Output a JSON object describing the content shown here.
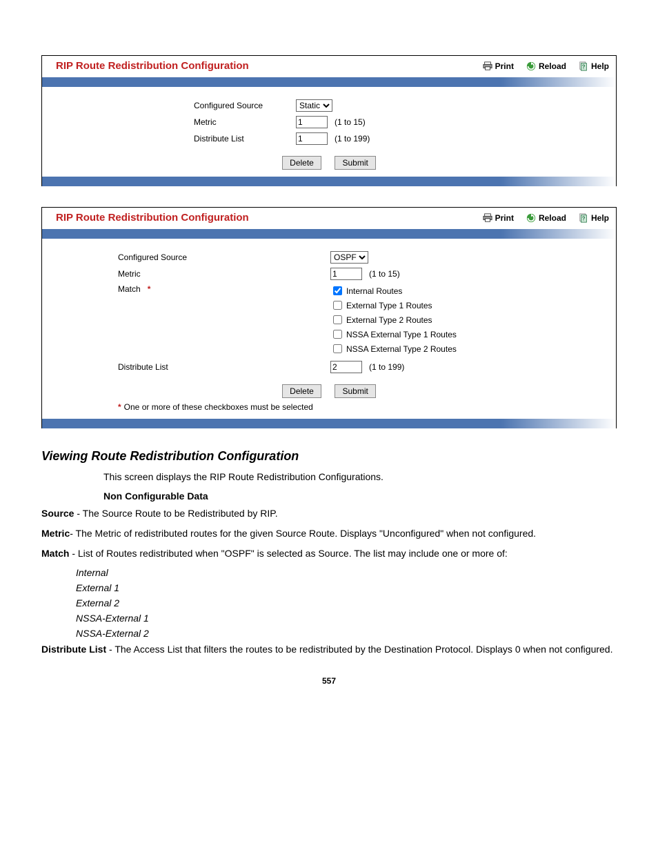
{
  "header_buttons": {
    "print": "Print",
    "reload": "Reload",
    "help": "Help"
  },
  "panel1": {
    "title": "RIP Route Redistribution Configuration",
    "configured_source_label": "Configured Source",
    "configured_source_value": "Static",
    "metric_label": "Metric",
    "metric_value": "1",
    "metric_hint": "(1 to 15)",
    "distribute_label": "Distribute List",
    "distribute_value": "1",
    "distribute_hint": "(1 to 199)",
    "delete_label": "Delete",
    "submit_label": "Submit"
  },
  "panel2": {
    "title": "RIP Route Redistribution Configuration",
    "configured_source_label": "Configured Source",
    "configured_source_value": "OSPF",
    "metric_label": "Metric",
    "metric_value": "1",
    "metric_hint": "(1 to 15)",
    "match_label": "Match",
    "match_options": {
      "opt1": "Internal Routes",
      "opt2": "External Type 1 Routes",
      "opt3": "External Type 2 Routes",
      "opt4": "NSSA External Type 1 Routes",
      "opt5": "NSSA External Type 2 Routes"
    },
    "distribute_label": "Distribute List",
    "distribute_value": "2",
    "distribute_hint": "(1 to 199)",
    "delete_label": "Delete",
    "submit_label": "Submit",
    "footnote": "One or more of these checkboxes must be selected"
  },
  "doc": {
    "section_heading": "Viewing Route Redistribution Configuration",
    "intro": "This screen displays the RIP Route Redistribution Configurations.",
    "noncfg_heading": "Non Configurable Data",
    "source_term": "Source",
    "source_desc": " - The Source Route to be Redistributed by RIP.",
    "metric_term": "Metric",
    "metric_desc": "- The Metric of redistributed routes for the given Source Route. Displays \"Unconfigured\" when not configured.",
    "match_term": "Match",
    "match_desc": " - List of Routes redistributed when \"OSPF\" is selected as Source. The list may include one or more of:",
    "match_items": {
      "i1": "Internal",
      "i2": "External 1",
      "i3": "External 2",
      "i4": "NSSA-External 1",
      "i5": "NSSA-External 2"
    },
    "dist_term": "Distribute List",
    "dist_desc": " - The Access List that filters the routes to be redistributed by the Destination Protocol. Displays 0 when not configured.",
    "page_number": "557"
  }
}
